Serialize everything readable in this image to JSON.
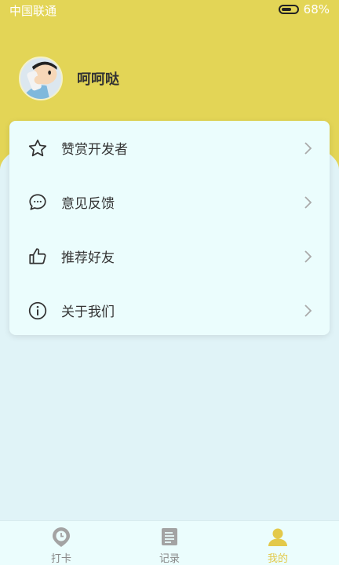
{
  "status_bar": {
    "carrier": "中国联通",
    "battery": "68%",
    "battery_level": 0.68
  },
  "profile": {
    "nickname": "呵呵哒"
  },
  "menu": [
    {
      "label": "赞赏开发者",
      "icon": "star-icon"
    },
    {
      "label": "意见反馈",
      "icon": "chat-bubble-icon"
    },
    {
      "label": "推荐好友",
      "icon": "thumbs-up-icon"
    },
    {
      "label": "关于我们",
      "icon": "info-icon"
    }
  ],
  "tabs": [
    {
      "label": "打卡",
      "icon": "clock-pin-icon",
      "active": false
    },
    {
      "label": "记录",
      "icon": "document-icon",
      "active": false
    },
    {
      "label": "我的",
      "icon": "user-icon",
      "active": true
    }
  ],
  "colors": {
    "accent": "#e3d556",
    "background": "#e0f3f7",
    "card": "#ebfdfd",
    "active_tab": "#e3c94a"
  }
}
